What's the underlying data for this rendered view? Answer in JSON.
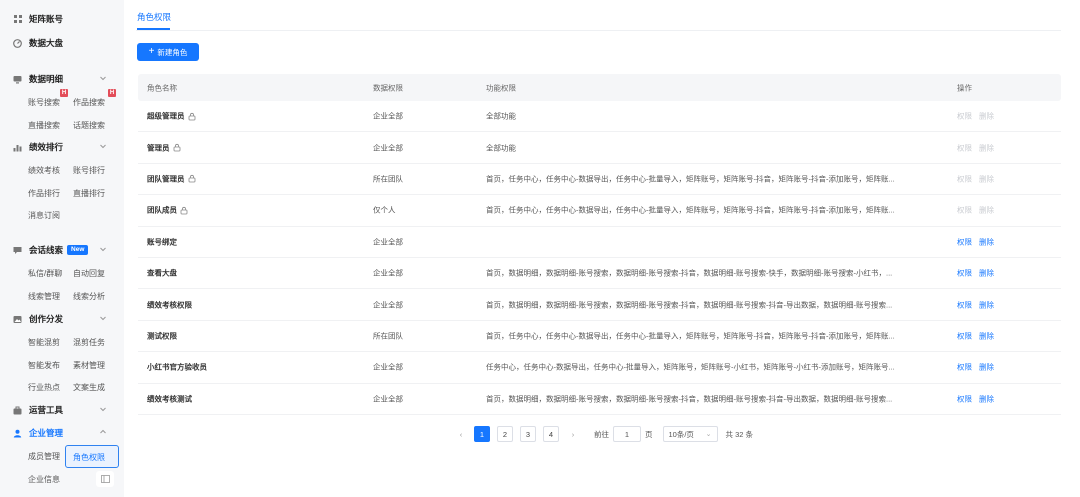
{
  "sidebar": {
    "groups": {
      "matrix": {
        "label": "矩阵账号",
        "icon": "grid-icon"
      },
      "dashboard": {
        "label": "数据大盘",
        "icon": "gauge-icon"
      },
      "detail": {
        "label": "数据明细",
        "icon": "monitor-icon",
        "items": [
          "账号搜索",
          "作品搜索",
          "直播搜索",
          "话题搜索"
        ],
        "badge": "H"
      },
      "performance": {
        "label": "绩效排行",
        "icon": "bar-chart-icon",
        "items": [
          "绩效考核",
          "账号排行",
          "作品排行",
          "直播排行",
          "消息订阅"
        ]
      },
      "leads": {
        "label": "会话线索",
        "icon": "chat-icon",
        "badge": "New",
        "items": [
          "私信/群聊",
          "自动回复",
          "线索管理",
          "线索分析"
        ]
      },
      "creation": {
        "label": "创作分发",
        "icon": "image-icon",
        "items": [
          "智能混剪",
          "混剪任务",
          "智能发布",
          "素材管理",
          "行业热点",
          "文案生成"
        ]
      },
      "ops": {
        "label": "运营工具",
        "icon": "toolbox-icon"
      },
      "enterprise": {
        "label": "企业管理",
        "icon": "user-icon",
        "items": [
          "成员管理",
          "角色权限",
          "企业信息"
        ]
      }
    },
    "active_item": "角色权限"
  },
  "main": {
    "tab": "角色权限",
    "new_button": "新建角色",
    "columns": {
      "name": "角色名称",
      "data": "数据权限",
      "func": "功能权限",
      "ops": "操作"
    },
    "rows": [
      {
        "name": "超级管理员",
        "locked": true,
        "data": "企业全部",
        "func": "全部功能",
        "perm": "权限",
        "del": "删除",
        "enabled": false
      },
      {
        "name": "管理员",
        "locked": true,
        "data": "企业全部",
        "func": "全部功能",
        "perm": "权限",
        "del": "删除",
        "enabled": false
      },
      {
        "name": "团队管理员",
        "locked": true,
        "data": "所在团队",
        "func": "首页，任务中心，任务中心-数据导出，任务中心-批量导入，矩阵账号，矩阵账号-抖音，矩阵账号-抖音-添加账号，矩阵账...",
        "perm": "权限",
        "del": "删除",
        "enabled": false
      },
      {
        "name": "团队成员",
        "locked": true,
        "data": "仅个人",
        "func": "首页，任务中心，任务中心-数据导出，任务中心-批量导入，矩阵账号，矩阵账号-抖音，矩阵账号-抖音-添加账号，矩阵账...",
        "perm": "权限",
        "del": "删除",
        "enabled": false
      },
      {
        "name": "账号绑定",
        "locked": false,
        "data": "企业全部",
        "func": "",
        "perm": "权限",
        "del": "删除",
        "enabled": true
      },
      {
        "name": "查看大盘",
        "locked": false,
        "data": "企业全部",
        "func": "首页，数据明细，数据明细-账号搜索，数据明细-账号搜索-抖音，数据明细-账号搜索-快手，数据明细-账号搜索-小红书，...",
        "perm": "权限",
        "del": "删除",
        "enabled": true
      },
      {
        "name": "绩效考核权限",
        "locked": false,
        "data": "企业全部",
        "func": "首页，数据明细，数据明细-账号搜索，数据明细-账号搜索-抖音，数据明细-账号搜索-抖音-导出数据，数据明细-账号搜索...",
        "perm": "权限",
        "del": "删除",
        "enabled": true
      },
      {
        "name": "测试权限",
        "locked": false,
        "data": "所在团队",
        "func": "首页，任务中心，任务中心-数据导出，任务中心-批量导入，矩阵账号，矩阵账号-抖音，矩阵账号-抖音-添加账号，矩阵账...",
        "perm": "权限",
        "del": "删除",
        "enabled": true
      },
      {
        "name": "小红书官方验收员",
        "locked": false,
        "data": "企业全部",
        "func": "任务中心，任务中心-数据导出，任务中心-批量导入，矩阵账号，矩阵账号-小红书，矩阵账号-小红书-添加账号，矩阵账号...",
        "perm": "权限",
        "del": "删除",
        "enabled": true
      },
      {
        "name": "绩效考核测试",
        "locked": false,
        "data": "企业全部",
        "func": "首页，数据明细，数据明细-账号搜索，数据明细-账号搜索-抖音，数据明细-账号搜索-抖音-导出数据，数据明细-账号搜索...",
        "perm": "权限",
        "del": "删除",
        "enabled": true
      }
    ],
    "pagination": {
      "pages": [
        "1",
        "2",
        "3",
        "4"
      ],
      "current": "1",
      "goto_label": "前往",
      "goto_value": "1",
      "page_suffix": "页",
      "page_size": "10条/页",
      "total": "共 32 条"
    }
  },
  "colors": {
    "accent": "#1677ff",
    "badge_red": "#e34d59",
    "sidebar_bg": "#f6f7f9"
  }
}
